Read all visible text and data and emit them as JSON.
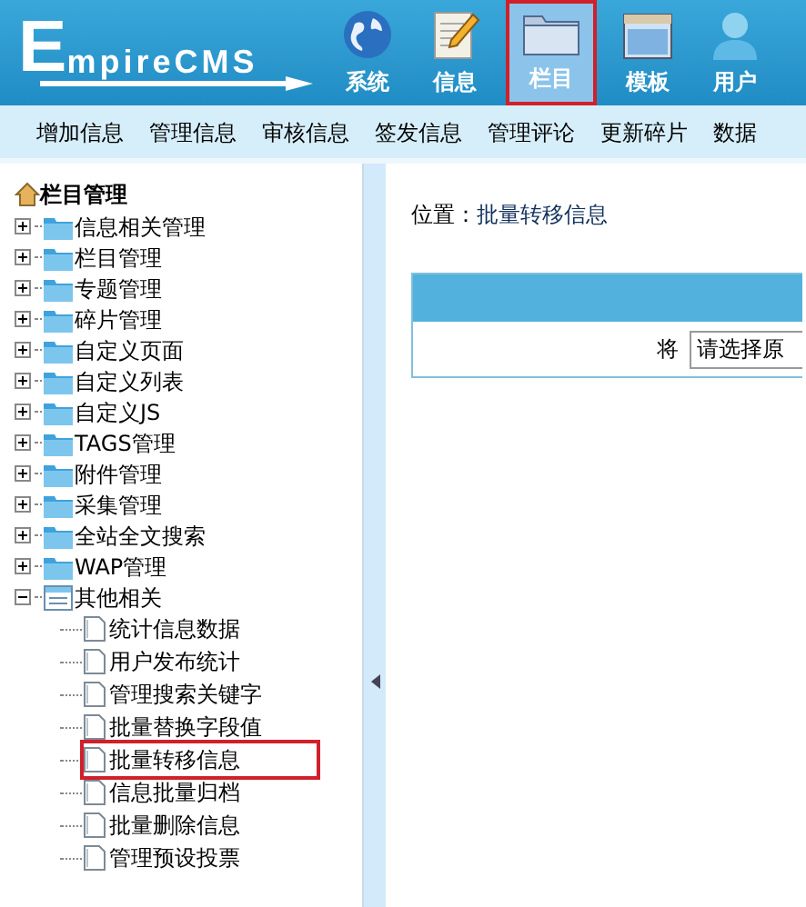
{
  "header": {
    "logo_initial": "E",
    "logo_rest": "mpireCMS",
    "tabs": [
      {
        "label": "系统",
        "kind": "globe",
        "selected": false
      },
      {
        "label": "信息",
        "kind": "note",
        "selected": false
      },
      {
        "label": "栏目",
        "kind": "folder",
        "selected": true
      },
      {
        "label": "模板",
        "kind": "window",
        "selected": false
      },
      {
        "label": "用户",
        "kind": "user",
        "selected": false
      }
    ]
  },
  "menu": [
    "增加信息",
    "管理信息",
    "审核信息",
    "签发信息",
    "管理评论",
    "更新碎片",
    "数据"
  ],
  "tree": {
    "title": "栏目管理",
    "nodes": [
      {
        "label": "信息相关管理",
        "expanded": false
      },
      {
        "label": "栏目管理",
        "expanded": false
      },
      {
        "label": "专题管理",
        "expanded": false
      },
      {
        "label": "碎片管理",
        "expanded": false
      },
      {
        "label": "自定义页面",
        "expanded": false
      },
      {
        "label": "自定义列表",
        "expanded": false
      },
      {
        "label": "自定义JS",
        "expanded": false
      },
      {
        "label": "TAGS管理",
        "expanded": false
      },
      {
        "label": "附件管理",
        "expanded": false
      },
      {
        "label": "采集管理",
        "expanded": false
      },
      {
        "label": "全站全文搜索",
        "expanded": false
      },
      {
        "label": "WAP管理",
        "expanded": false
      },
      {
        "label": "其他相关",
        "expanded": true,
        "children": [
          {
            "label": "统计信息数据",
            "selected": false
          },
          {
            "label": "用户发布统计",
            "selected": false
          },
          {
            "label": "管理搜索关键字",
            "selected": false
          },
          {
            "label": "批量替换字段值",
            "selected": false
          },
          {
            "label": "批量转移信息",
            "selected": true
          },
          {
            "label": "信息批量归档",
            "selected": false
          },
          {
            "label": "批量删除信息",
            "selected": false
          },
          {
            "label": "管理预设投票",
            "selected": false
          }
        ]
      }
    ]
  },
  "content": {
    "location_label": "位置：",
    "location_link": "批量转移信息",
    "form_label": "将",
    "select_value": "请选择原"
  }
}
